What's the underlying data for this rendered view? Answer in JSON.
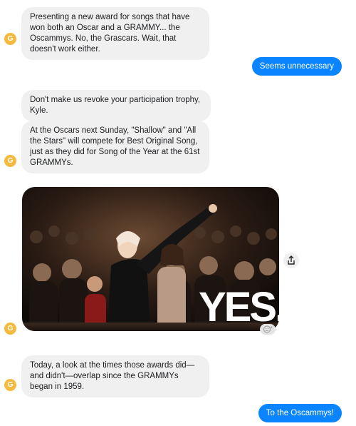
{
  "avatar": {
    "initial": "G",
    "color": "#f5b93d"
  },
  "messages": {
    "m1": "Presenting a new award for songs that have won both an Oscar and a GRAMMY... the Oscammys. No, the Grascars. Wait, that doesn't work either.",
    "reply1": "Seems unnecessary",
    "m2": "Don't make us revoke your participation trophy, Kyle.",
    "m3": "At the Oscars next Sunday, \"Shallow\" and \"All the Stars\" will compete for Best Original Song, just as they did for Song of the Year at the 61st GRAMMYs.",
    "gif_caption": "YES.",
    "m4": "Today, a look at the times those awards did—and didn't—overlap since the GRAMMYs began in 1959.",
    "reply2": "To the Oscammys!"
  },
  "colors": {
    "outgoing": "#0a84ff",
    "incoming": "#f0f0f0"
  }
}
